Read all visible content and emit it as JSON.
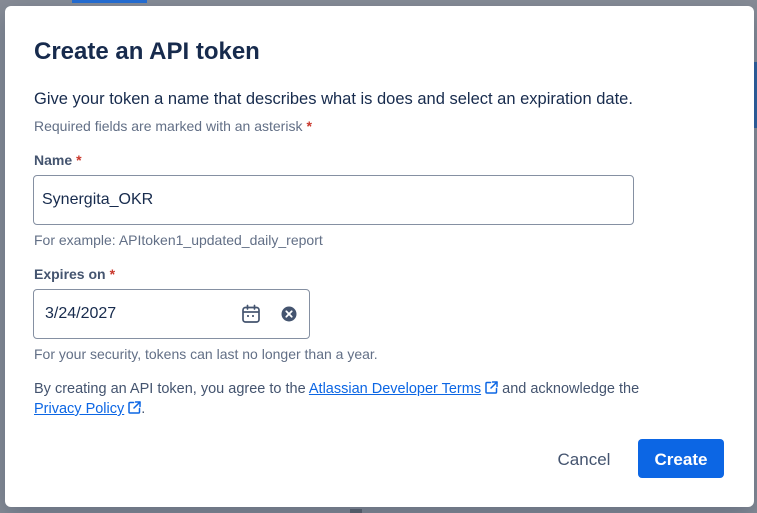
{
  "dialog": {
    "title": "Create an API token",
    "description": "Give your token a name that describes what is does and select an expiration date.",
    "required_note": "Required fields are marked with an asterisk",
    "required_marker": "*"
  },
  "name_field": {
    "label": "Name",
    "value": "Synergita_OKR",
    "helper": "For example: APItoken1_updated_daily_report"
  },
  "expires_field": {
    "label": "Expires on",
    "value": "3/24/2027",
    "helper": "For your security, tokens can last no longer than a year.",
    "icons": [
      "calendar-icon",
      "clear-icon"
    ]
  },
  "terms": {
    "prefix": "By creating an API token, you agree to the",
    "developer_terms_link": "Atlassian Developer Terms",
    "middle": "and acknowledge the",
    "privacy_link": "Privacy Policy",
    "suffix": "."
  },
  "actions": {
    "cancel_label": "Cancel",
    "create_label": "Create"
  },
  "colors": {
    "primary": "#0c66e4",
    "required": "#c9372c",
    "text": "#172b4d",
    "subtle_text": "#626f86"
  }
}
